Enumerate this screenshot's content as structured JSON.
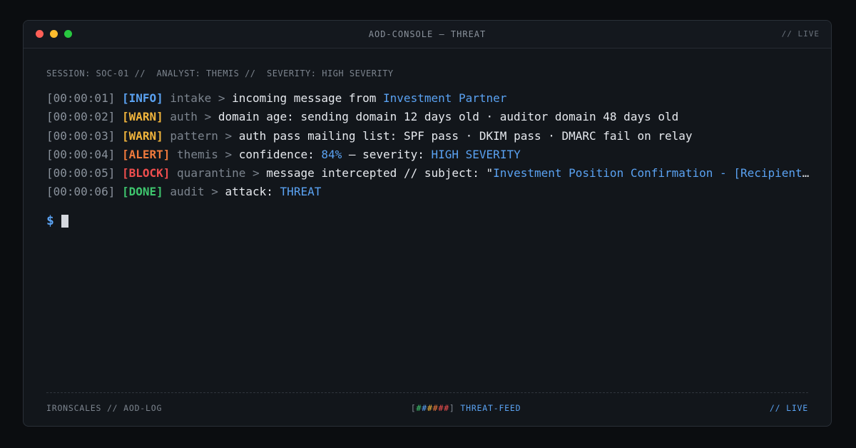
{
  "window": {
    "title": "AOD-CONSOLE — THREAT",
    "status": "// LIVE"
  },
  "session": {
    "line": "SESSION: SOC-01 //  ANALYST: THEMIS //  SEVERITY: HIGH SEVERITY"
  },
  "log": [
    {
      "ts": "[00:00:01]",
      "tag": "[INFO]",
      "tag_color": "#5aa2f2",
      "module": "intake",
      "sep": " > ",
      "text": "incoming message from ",
      "hl": "Investment Partner",
      "tail": ""
    },
    {
      "ts": "[00:00:02]",
      "tag": "[WARN]",
      "tag_color": "#f0b43c",
      "module": "auth",
      "sep": " > ",
      "text": "domain age: sending domain 12 days old · auditor domain 48 days old",
      "hl": "",
      "tail": ""
    },
    {
      "ts": "[00:00:03]",
      "tag": "[WARN]",
      "tag_color": "#f0b43c",
      "module": "pattern",
      "sep": " > ",
      "text": "auth pass mailing list: SPF pass · DKIM pass · DMARC fail on relay",
      "hl": "",
      "tail": ""
    },
    {
      "ts": "[00:00:04]",
      "tag": "[ALERT]",
      "tag_color": "#f07a3c",
      "module": "themis",
      "sep": " > ",
      "text": "confidence: ",
      "hl": "84%",
      "tail": " — severity: ",
      "hl2": "HIGH SEVERITY"
    },
    {
      "ts": "[00:00:05]",
      "tag": "[BLOCK]",
      "tag_color": "#ef4e4e",
      "module": "quarantine",
      "sep": " > ",
      "text": "message intercepted // subject: \"",
      "hl": "Investment Position Confirmation - [Recipient Name]",
      "tail": ""
    },
    {
      "ts": "[00:00:06]",
      "tag": "[DONE]",
      "tag_color": "#3ec46d",
      "module": "audit",
      "sep": " > ",
      "text": "attack: ",
      "hl": "THREAT",
      "tail": ""
    }
  ],
  "prompt": {
    "symbol": "$"
  },
  "footer": {
    "left": "IRONSCALES // AOD-LOG",
    "bar_open": "[",
    "bar_fill": "######",
    "bar_close": "]",
    "feed": " THREAT-FEED",
    "right": "// LIVE"
  },
  "colors": {
    "accent": "#5aa2f2",
    "info": "#5aa2f2",
    "warn": "#f0b43c",
    "alert": "#f07a3c",
    "block": "#ef4e4e",
    "done": "#3ec46d"
  }
}
